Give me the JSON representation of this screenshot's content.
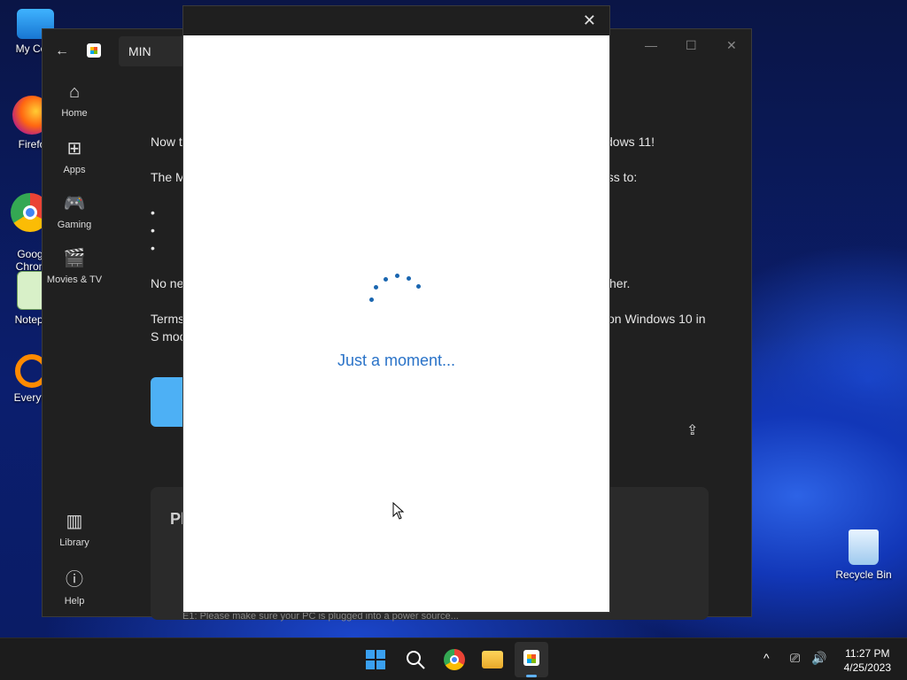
{
  "desktop": {
    "icons": [
      {
        "label": "My Com",
        "icon": "computer-icon"
      },
      {
        "label": "Firefo",
        "icon": "firefox-icon"
      },
      {
        "label": "Goog\nChron",
        "icon": "chrome-icon"
      },
      {
        "label": "Notepa",
        "icon": "notepad-icon"
      },
      {
        "label": "Everyth",
        "icon": "everything-icon"
      },
      {
        "label": "Recycle Bin",
        "icon": "recycle-bin-icon"
      }
    ]
  },
  "store": {
    "search_value": "MIN",
    "nav": [
      {
        "label": "Home",
        "icon": "home-icon"
      },
      {
        "label": "Apps",
        "icon": "apps-icon"
      },
      {
        "label": "Gaming",
        "icon": "gaming-icon"
      },
      {
        "label": "Movies & TV",
        "icon": "movies-icon"
      },
      {
        "label": "Library",
        "icon": "library-icon"
      },
      {
        "label": "Help",
        "icon": "help-icon"
      }
    ],
    "content": {
      "line1_left": "Now t",
      "line1_right": "dows 11!",
      "line2_left": "The M",
      "line2_right": "ess to:",
      "bullets": [
        "•",
        "•",
        "•"
      ],
      "line3_left": "No ne",
      "line3_right": "cher.",
      "line4_left": "Terms",
      "line4_right": "on Windows 10 in",
      "line5_left": "S moc",
      "pane_title": "Pl",
      "pane_footer": "E1: Please make sure your PC is plugged into a power source..."
    }
  },
  "dialog": {
    "close_glyph": "✕",
    "loading_text": "Just a moment..."
  },
  "taskbar": {
    "time": "11:27 PM",
    "date": "4/25/2023"
  },
  "colors": {
    "accent": "#2a73c8",
    "spinner": "#1a66b0",
    "taskbar": "#1c1c1c"
  }
}
